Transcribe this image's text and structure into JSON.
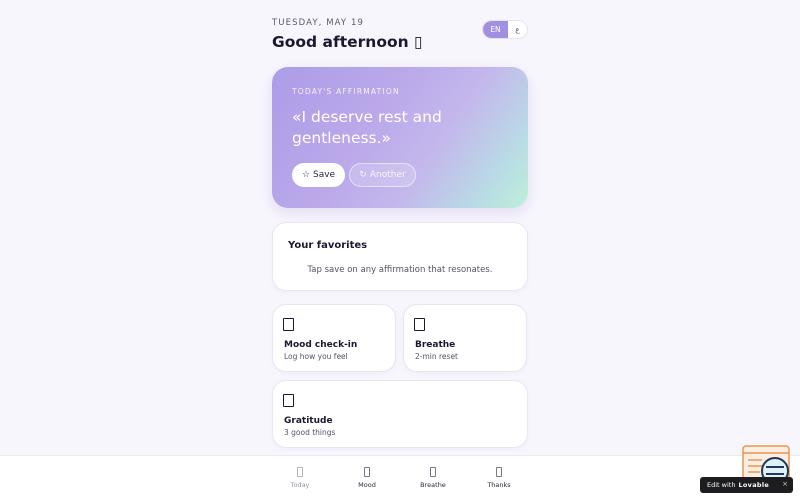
{
  "header": {
    "date": "TUESDAY, MAY 19",
    "greeting": "Good afternoon ▯",
    "lang_en": "EN",
    "lang_ar": "ع"
  },
  "affirmation": {
    "label": "TODAY'S AFFIRMATION",
    "quote": "«I deserve rest and gentleness.»",
    "save_icon": "☆",
    "save_label": "Save",
    "another_icon": "↻",
    "another_label": "Another"
  },
  "favorites": {
    "title": "Your favorites",
    "empty_text": "Tap save on any affirmation that resonates."
  },
  "tiles": [
    {
      "title": "Mood check-in",
      "subtitle": "Log how you feel"
    },
    {
      "title": "Breathe",
      "subtitle": "2-min reset"
    },
    {
      "title": "Gratitude",
      "subtitle": "3 good things"
    }
  ],
  "nav": [
    {
      "label": "Today",
      "active": true
    },
    {
      "label": "Mood"
    },
    {
      "label": "Breathe"
    },
    {
      "label": "Thanks"
    }
  ],
  "badge": {
    "prefix": "Edit with",
    "brand": "Lovable",
    "close": "×"
  },
  "colors": {
    "accent": "#a38fe0",
    "background": "#f8f6fd",
    "hero_start": "#ad9ce8",
    "hero_end": "#bdf0d8"
  }
}
